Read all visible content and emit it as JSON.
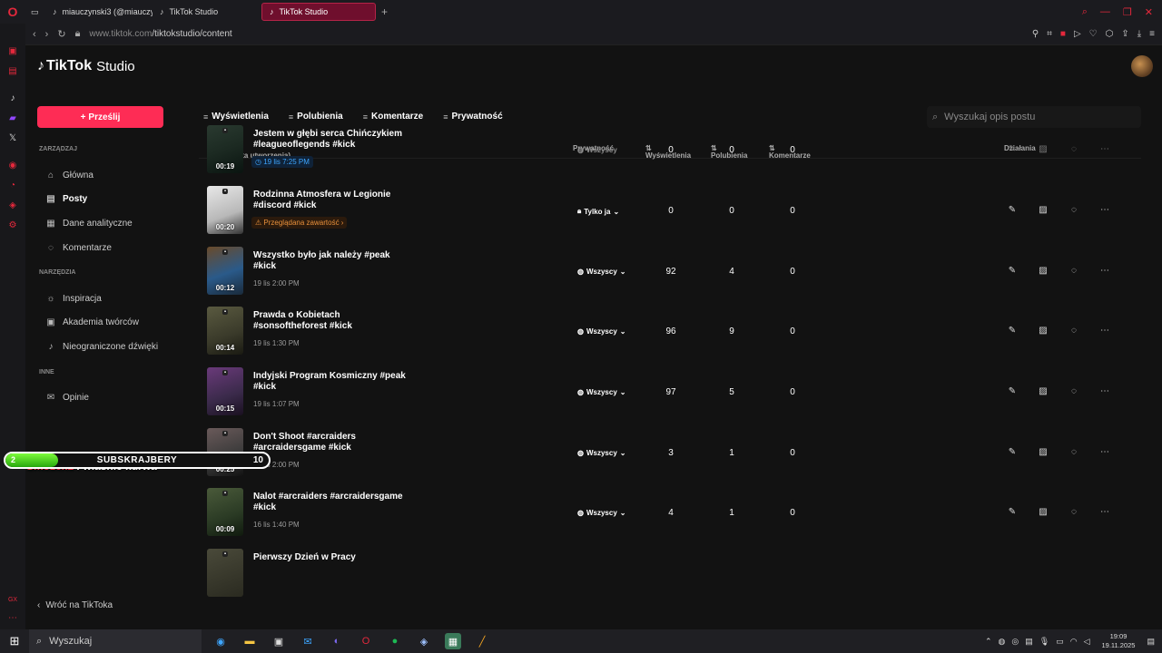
{
  "browser": {
    "tabs": [
      {
        "label": "miauczynski3 (@miauczy",
        "active": false
      },
      {
        "label": "TikTok Studio",
        "active": false
      },
      {
        "label": "TikTok Studio",
        "active": true
      }
    ],
    "url_host": "www.tiktok.com",
    "url_path": "/tiktokstudio/content"
  },
  "app": {
    "logo": "TikTok",
    "logo_suffix": "Studio",
    "upload_label": "Prześlij",
    "sections": {
      "manage": "ZARZĄDZAJ",
      "tools": "NARZĘDZIA",
      "other": "INNE"
    },
    "nav": {
      "home": "Główna",
      "posts": "Posty",
      "analytics": "Dane analityczne",
      "comments": "Komentarze",
      "inspiration": "Inspiracja",
      "academy": "Akademia twórców",
      "sounds": "Nieograniczone dźwięki",
      "feedback": "Opinie"
    },
    "back_label": "Wróć na TikToka"
  },
  "filters": [
    "Wyświetlenia",
    "Polubienia",
    "Komentarze",
    "Prywatność"
  ],
  "search": {
    "placeholder": "Wyszukaj opis postu"
  },
  "table": {
    "headers": {
      "content": "Treści (Data utworzenia)",
      "privacy": "Prywatność",
      "views": "Wyświetlenia",
      "likes": "Polubienia",
      "comments": "Komentarze",
      "actions": "Działania"
    },
    "rows": [
      {
        "title": "Jestem w głębi serca Chińczykiem #leagueoflegends #kick",
        "meta": "19 lis 7:25 PM",
        "meta_type": "scheduled",
        "duration": "00:19",
        "privacy": "Wszyscy",
        "views": "0",
        "likes": "0",
        "comments": "0"
      },
      {
        "title": "Rodzinna Atmosfera w Legionie #discord #kick",
        "meta": "Przeglądana zawartość ›",
        "meta_type": "review",
        "duration": "00:20",
        "privacy": "Tylko ja",
        "views": "0",
        "likes": "0",
        "comments": "0"
      },
      {
        "title": "Wszystko było jak należy #peak #kick",
        "meta": "19 lis 2:00 PM",
        "meta_type": "date",
        "duration": "00:12",
        "privacy": "Wszyscy",
        "views": "92",
        "likes": "4",
        "comments": "0"
      },
      {
        "title": "Prawda o Kobietach #sonsoftheforest #kick",
        "meta": "19 lis 1:30 PM",
        "meta_type": "date",
        "duration": "00:14",
        "privacy": "Wszyscy",
        "views": "96",
        "likes": "9",
        "comments": "0"
      },
      {
        "title": "Indyjski Program Kosmiczny #peak #kick",
        "meta": "19 lis 1:07 PM",
        "meta_type": "date",
        "duration": "00:15",
        "privacy": "Wszyscy",
        "views": "97",
        "likes": "5",
        "comments": "0"
      },
      {
        "title": "Don't Shoot #arcraiders #arcraidersgame #kick",
        "meta": "16 lis 2:00 PM",
        "meta_type": "date",
        "duration": "00:25",
        "privacy": "Wszyscy",
        "views": "3",
        "likes": "1",
        "comments": "0"
      },
      {
        "title": "Nalot #arcraiders #arcraidersgame #kick",
        "meta": "16 lis 1:40 PM",
        "meta_type": "date",
        "duration": "00:09",
        "privacy": "Wszyscy",
        "views": "4",
        "likes": "1",
        "comments": "0"
      },
      {
        "title": "Pierwszy Dzień w Pracy",
        "meta": "",
        "meta_type": "date",
        "duration": "",
        "privacy": "",
        "views": "",
        "likes": "",
        "comments": ""
      }
    ]
  },
  "overlay": {
    "badge_num": "1",
    "chat_user": "Smozek1",
    "chat_msg": ": właśnie kurwa",
    "sub_count": "2",
    "sub_label": "SUBSKRAJBERY",
    "sub_goal": "10",
    "sub_progress": 0.2
  },
  "taskbar": {
    "search_label": "Wyszukaj",
    "time": "19:09",
    "date": "19.11.2025"
  }
}
